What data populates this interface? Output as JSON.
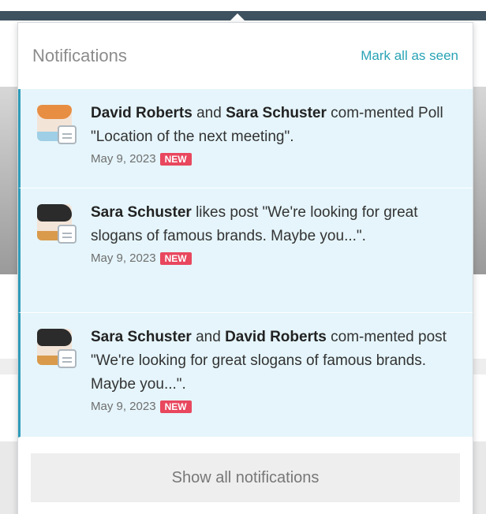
{
  "header": {
    "title": "Notifications",
    "mark_all": "Mark all as seen"
  },
  "notifications": [
    {
      "user1": "David Roberts",
      "join": "and",
      "user2": "Sara Schuster",
      "text": "com-mented Poll \"Location of the next meeting\".",
      "date": "May 9, 2023",
      "badge": "NEW",
      "avatar": "male-avatar-icon"
    },
    {
      "user1": "Sara Schuster",
      "text": "likes post \"We're looking for great slogans of famous brands. Maybe you...\".",
      "date": "May 9, 2023",
      "badge": "NEW",
      "avatar": "female-avatar-icon"
    },
    {
      "user1": "Sara Schuster",
      "join": "and",
      "user2": "David Roberts",
      "text": "com-mented post \"We're looking for great slogans of famous brands. Maybe you...\".",
      "date": "May 9, 2023",
      "badge": "NEW",
      "avatar": "female-avatar-icon"
    }
  ],
  "footer": {
    "show_all": "Show all notifications"
  },
  "colors": {
    "accent": "#2aa3b5",
    "unread_bg": "#e5f5fb",
    "badge": "#e8475e",
    "navbar": "#3f5260"
  }
}
